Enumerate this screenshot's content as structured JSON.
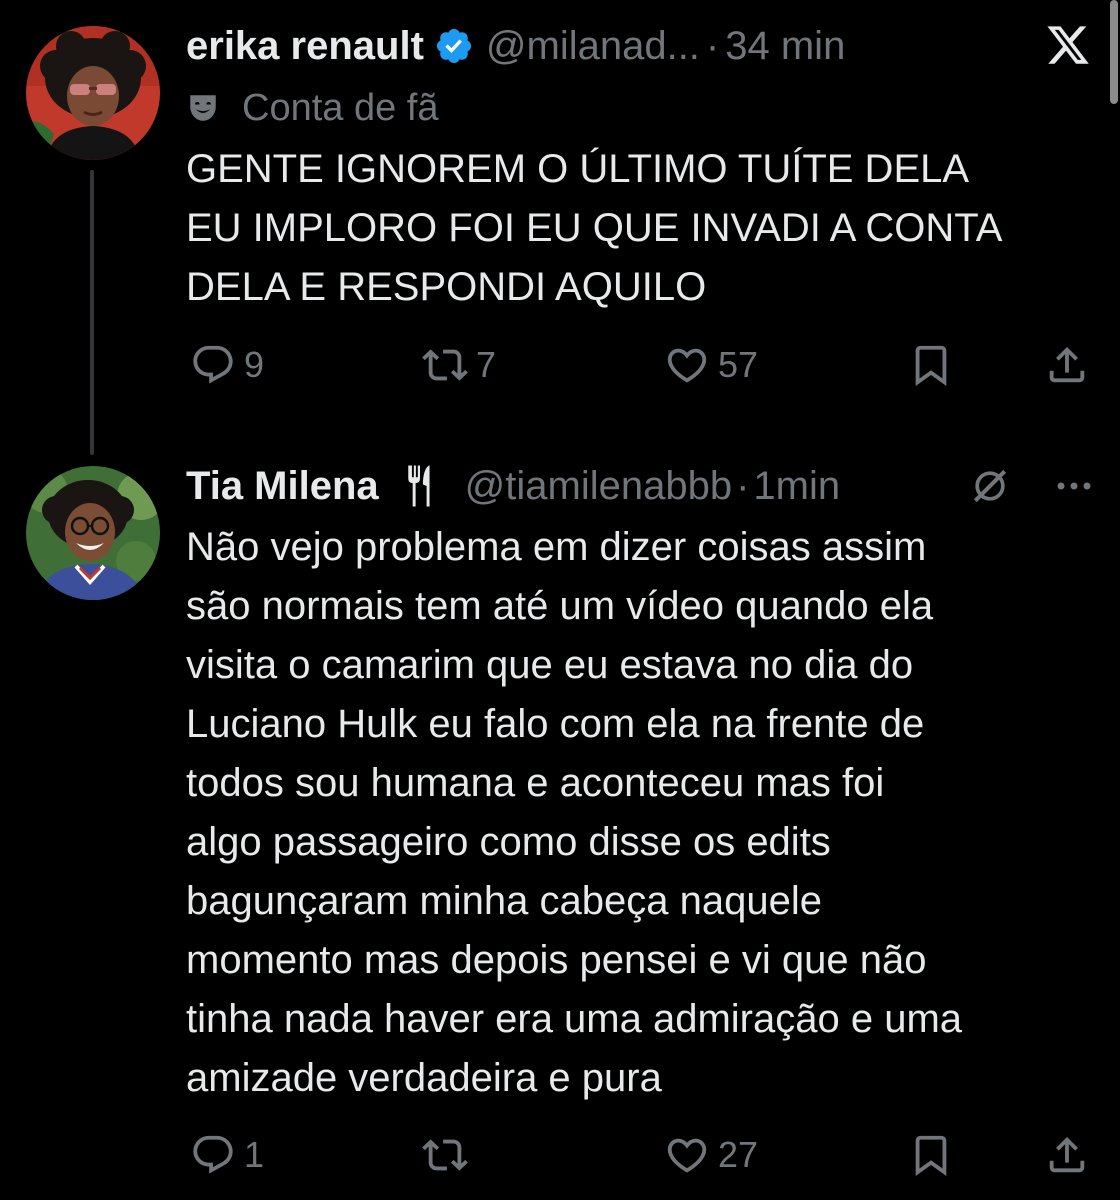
{
  "tweets": [
    {
      "author_name": "erika renault",
      "handle": "@milanad...",
      "separator": "·",
      "time": "34 min",
      "label": "Conta de fã",
      "text": "GENTE IGNOREM O ÚLTIMO TUÍTE DELA\nEU IMPLORO FOI EU QUE INVADI A CONTA\nDELA E RESPONDI AQUILO",
      "replies": "9",
      "reposts": "7",
      "likes": "57"
    },
    {
      "author_name": "Tia Milena",
      "handle": "@tiamilenabbb",
      "separator": "·",
      "time": "1min",
      "text": "Não vejo problema em dizer coisas assim\nsão normais tem até um vídeo quando ela\nvisita o camarim que eu estava no dia do\nLuciano Hulk eu falo com ela na frente de\ntodos sou humana e aconteceu mas foi\nalgo passageiro como disse os edits\nbagunçaram minha cabeça naquele\nmomento mas depois pensei e vi que não\ntinha nada haver era uma admiração e uma\namizade verdadeira e pura",
      "replies": "1",
      "reposts": "",
      "likes": "27"
    }
  ],
  "icons": {
    "verified": "verified-badge-icon",
    "fan_label": "theater-mask-icon",
    "utensils": "fork-knife-icon",
    "app_logo": "x-logo-icon",
    "grok": "grok-icon",
    "more": "more-icon",
    "reply": "reply-icon",
    "repost": "repost-icon",
    "like": "like-icon",
    "bookmark": "bookmark-icon",
    "share": "share-icon"
  },
  "colors": {
    "background": "#000000",
    "text": "#e7e9ea",
    "secondary": "#71767b",
    "verified_blue": "#1d9bf0"
  }
}
